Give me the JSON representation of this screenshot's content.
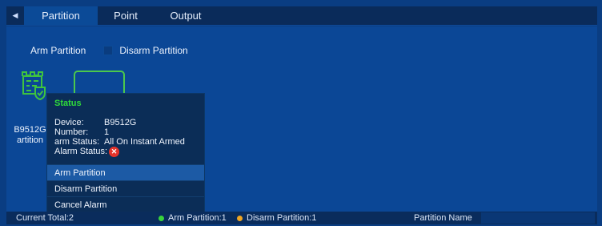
{
  "tabs": {
    "partition": "Partition",
    "point": "Point",
    "output": "Output"
  },
  "actions": {
    "arm": "Arm Partition",
    "disarm": "Disarm Partition"
  },
  "partition": {
    "label_line1": "B9512G",
    "label_line2": "artition"
  },
  "popup": {
    "title": "Status",
    "device_key": "Device:",
    "device_val": "B9512G",
    "number_key": "Number:",
    "number_val": "1",
    "arm_key": "arm Status:",
    "arm_val": "All On Instant Armed",
    "alarm_key": "Alarm Status:",
    "alarm_icon": "x-circle-icon",
    "menu": [
      "Arm Partition",
      "Disarm Partition",
      "Cancel Alarm"
    ]
  },
  "statusbar": {
    "total": "Current Total:2",
    "arm": "Arm Partition:1",
    "disarm": "Disarm Partition:1",
    "name_label": "Partition Name"
  },
  "colors": {
    "background": "#0a3d82",
    "accent_green": "#2fdb3a",
    "alarm_red": "#e5332a",
    "disarm_orange": "#f0a623"
  }
}
